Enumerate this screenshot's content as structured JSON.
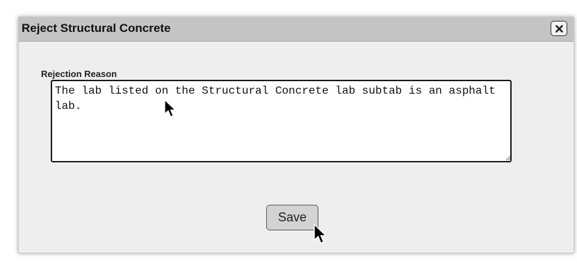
{
  "dialog": {
    "title": "Reject Structural Concrete",
    "close_icon": "close-icon"
  },
  "form": {
    "rejection_label": "Rejection Reason",
    "rejection_value": "The lab listed on the Structural Concrete lab subtab is an asphalt lab.",
    "save_label": "Save"
  },
  "colors": {
    "titlebar_bg": "#c4c4c4",
    "dialog_bg": "#eeeeee",
    "button_bg": "#d3d3d3"
  }
}
